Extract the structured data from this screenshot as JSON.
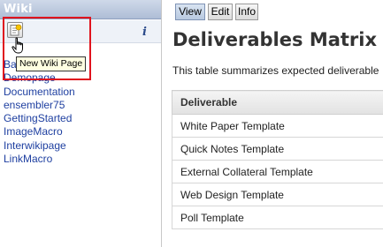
{
  "sidebar": {
    "title": "Wiki",
    "info_label": "i",
    "new_page_tooltip": "New Wiki Page",
    "pages": [
      "Ba",
      "Demopage",
      "Documentation",
      "ensembler75",
      "GettingStarted",
      "ImageMacro",
      "Interwikipage",
      "LinkMacro"
    ]
  },
  "tabs": {
    "view": "View",
    "edit": "Edit",
    "info": "Info",
    "active": "View"
  },
  "main": {
    "title": "Deliverables Matrix",
    "description": "This table summarizes expected deliverable",
    "table": {
      "header": "Deliverable",
      "rows": [
        "White Paper Template",
        "Quick Notes Template",
        "External Collateral Template",
        "Web Design Template",
        "Poll Template"
      ]
    }
  },
  "colors": {
    "link": "#1e3fa0",
    "highlight": "#e0141e",
    "tooltip_bg": "#ffffe1"
  }
}
